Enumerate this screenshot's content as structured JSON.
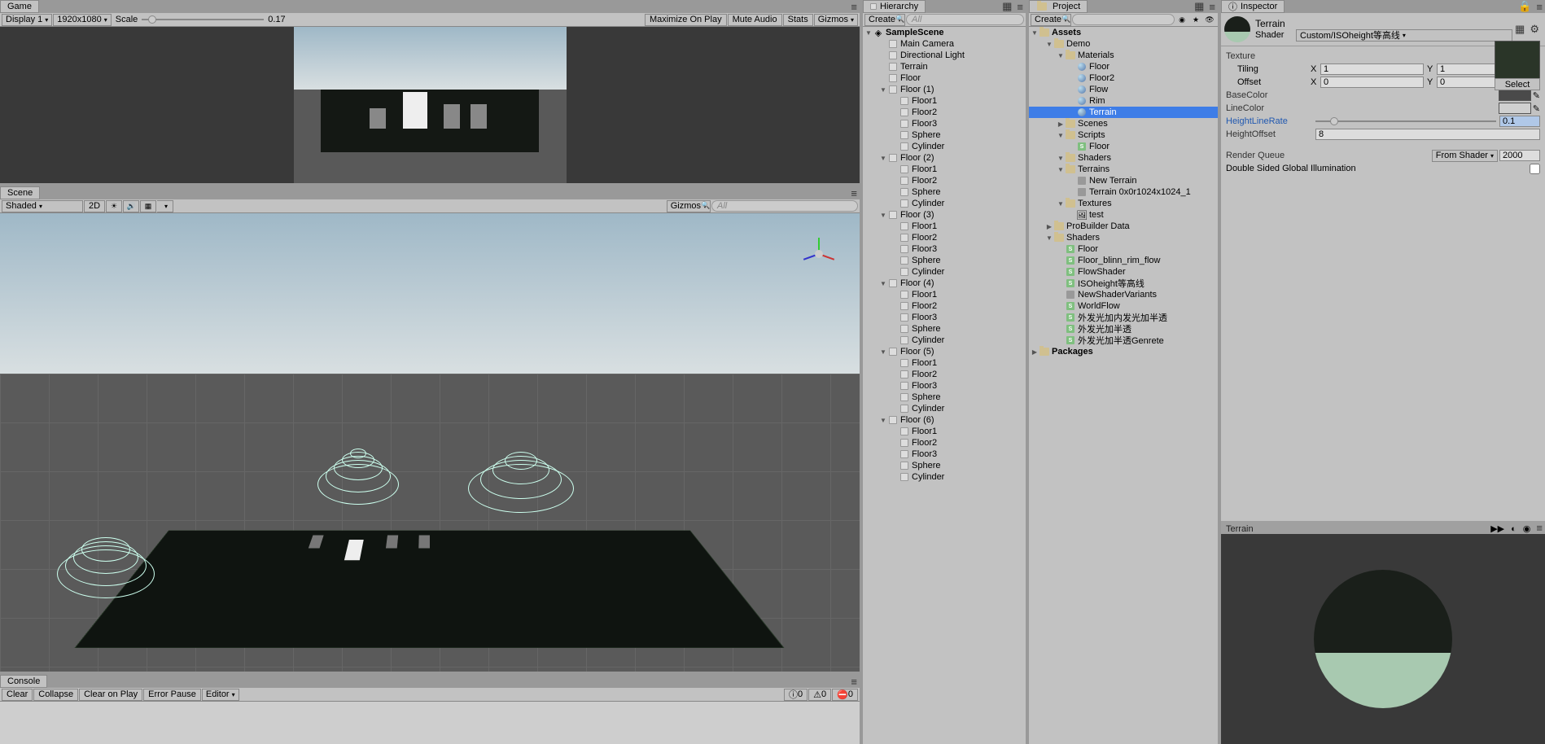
{
  "game": {
    "tab": "Game",
    "display": "Display 1",
    "resolution": "1920x1080",
    "scale_label": "Scale",
    "scale_value": "0.17",
    "maximize": "Maximize On Play",
    "mute": "Mute Audio",
    "stats": "Stats",
    "gizmos": "Gizmos"
  },
  "scene": {
    "tab": "Scene",
    "shading": "Shaded",
    "twod": "2D",
    "gizmos": "Gizmos"
  },
  "console": {
    "tab": "Console",
    "clear": "Clear",
    "collapse": "Collapse",
    "clearplay": "Clear on Play",
    "errorpause": "Error Pause",
    "editor": "Editor",
    "count0": "0",
    "count1": "0",
    "count2": "0"
  },
  "hierarchy": {
    "tab": "Hierarchy",
    "create": "Create",
    "search_hint": "All",
    "root": "SampleScene",
    "items": [
      "Main Camera",
      "Directional Light",
      "Terrain",
      "Floor",
      "Floor (1)",
      "Floor1",
      "Floor2",
      "Floor3",
      "Sphere",
      "Cylinder",
      "Floor (2)",
      "Floor1",
      "Floor2",
      "Sphere",
      "Cylinder",
      "Floor (3)",
      "Floor1",
      "Floor2",
      "Floor3",
      "Sphere",
      "Cylinder",
      "Floor (4)",
      "Floor1",
      "Floor2",
      "Floor3",
      "Sphere",
      "Cylinder",
      "Floor (5)",
      "Floor1",
      "Floor2",
      "Floor3",
      "Sphere",
      "Cylinder",
      "Floor (6)",
      "Floor1",
      "Floor2",
      "Floor3",
      "Sphere",
      "Cylinder"
    ],
    "indents": [
      1,
      1,
      1,
      1,
      1,
      2,
      2,
      2,
      2,
      2,
      1,
      2,
      2,
      2,
      2,
      1,
      2,
      2,
      2,
      2,
      2,
      1,
      2,
      2,
      2,
      2,
      2,
      1,
      2,
      2,
      2,
      2,
      2,
      1,
      2,
      2,
      2,
      2,
      2
    ],
    "folders": [
      false,
      false,
      false,
      false,
      true,
      false,
      false,
      false,
      false,
      false,
      true,
      false,
      false,
      false,
      false,
      true,
      false,
      false,
      false,
      false,
      false,
      true,
      false,
      false,
      false,
      false,
      false,
      true,
      false,
      false,
      false,
      false,
      false,
      true,
      false,
      false,
      false,
      false,
      false
    ]
  },
  "project": {
    "tab": "Project",
    "create": "Create",
    "assets": "Assets",
    "packages": "Packages",
    "tree": [
      {
        "d": 1,
        "f": true,
        "open": true,
        "t": "folder",
        "n": "Demo"
      },
      {
        "d": 2,
        "f": true,
        "open": true,
        "t": "folder",
        "n": "Materials"
      },
      {
        "d": 3,
        "t": "mat",
        "n": "Floor"
      },
      {
        "d": 3,
        "t": "mat",
        "n": "Floor2"
      },
      {
        "d": 3,
        "t": "mat",
        "n": "Flow"
      },
      {
        "d": 3,
        "t": "mat",
        "n": "Rim"
      },
      {
        "d": 3,
        "t": "mat",
        "n": "Terrain",
        "sel": true
      },
      {
        "d": 2,
        "f": true,
        "t": "folder",
        "n": "Scenes"
      },
      {
        "d": 2,
        "f": true,
        "open": true,
        "t": "folder",
        "n": "Scripts"
      },
      {
        "d": 3,
        "t": "shader",
        "n": "Floor"
      },
      {
        "d": 2,
        "f": true,
        "open": true,
        "t": "folder",
        "n": "Shaders"
      },
      {
        "d": 2,
        "f": true,
        "open": true,
        "t": "folder",
        "n": "Terrains"
      },
      {
        "d": 3,
        "t": "file",
        "n": "New Terrain"
      },
      {
        "d": 3,
        "t": "file",
        "n": "Terrain 0x0r1024x1024_1"
      },
      {
        "d": 2,
        "f": true,
        "open": true,
        "t": "folder",
        "n": "Textures"
      },
      {
        "d": 3,
        "t": "img",
        "n": "test"
      },
      {
        "d": 1,
        "f": true,
        "t": "folder",
        "n": "ProBuilder Data"
      },
      {
        "d": 1,
        "f": true,
        "open": true,
        "t": "folder",
        "n": "Shaders"
      },
      {
        "d": 2,
        "t": "shader",
        "n": "Floor"
      },
      {
        "d": 2,
        "t": "shader",
        "n": "Floor_blinn_rim_flow"
      },
      {
        "d": 2,
        "t": "shader",
        "n": "FlowShader"
      },
      {
        "d": 2,
        "t": "shader",
        "n": "ISOheight等高线"
      },
      {
        "d": 2,
        "t": "file2",
        "n": "NewShaderVariants"
      },
      {
        "d": 2,
        "t": "shader",
        "n": "WorldFlow"
      },
      {
        "d": 2,
        "t": "shader",
        "n": "外发光加内发光加半透"
      },
      {
        "d": 2,
        "t": "shader",
        "n": "外发光加半透"
      },
      {
        "d": 2,
        "t": "shader",
        "n": "外发光加半透Genrete"
      }
    ]
  },
  "inspector": {
    "tab": "Inspector",
    "title": "Terrain",
    "shader_label": "Shader",
    "shader_value": "Custom/ISOheight等高线",
    "texture": "Texture",
    "tiling": "Tiling",
    "offset": "Offset",
    "tiling_x": "1",
    "tiling_y": "1",
    "offset_x": "0",
    "offset_y": "0",
    "basecolor": "BaseColor",
    "linecolor": "LineColor",
    "heightlinerate": "HeightLineRate",
    "heightlinerate_val": "0.1",
    "heightoffset": "HeightOffset",
    "heightoffset_val": "8",
    "renderqueue": "Render Queue",
    "fromshader": "From Shader",
    "renderqueue_val": "2000",
    "doublesided": "Double Sided Global Illumination",
    "select": "Select",
    "preview_title": "Terrain",
    "x_label": "X",
    "y_label": "Y"
  }
}
